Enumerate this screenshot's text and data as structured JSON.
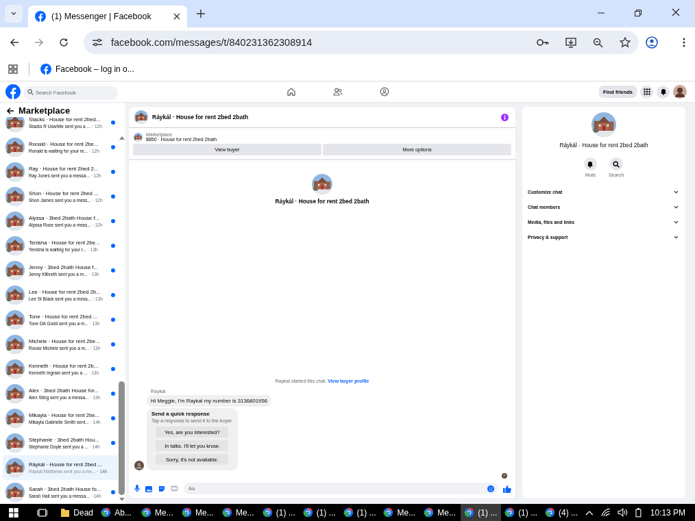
{
  "browser": {
    "tab_title": "(1) Messenger | Facebook",
    "url": "facebook.com/messages/t/840231362308914",
    "bookmark": "Facebook – log in o..."
  },
  "topbar": {
    "search_placeholder": "Search Facebook",
    "find_friends": "Find friends"
  },
  "sidebar": {
    "title": "Marketplace",
    "conversations": [
      {
        "name": "Stacks · House for rent 2bed...",
        "preview": "Stacks R Uswhite sent you a ...",
        "time": "· 12h",
        "unread": true,
        "selected": false
      },
      {
        "name": "Ronald · House for rent 2be...",
        "preview": "Ronald is waiting for your re...",
        "time": "· 12h",
        "unread": true,
        "selected": false
      },
      {
        "name": "Ray · House for rent 2bed 2...",
        "preview": "Ray Jones sent you a messa...",
        "time": "· 12h",
        "unread": true,
        "selected": false
      },
      {
        "name": "Shon · House for rent 2bed ...",
        "preview": "Shon James sent you a mess...",
        "time": "· 12h",
        "unread": true,
        "selected": false
      },
      {
        "name": "Alyssa · 3bed 2bath House f...",
        "preview": "Alyssa Rose sent you a mess...",
        "time": "· 12h",
        "unread": true,
        "selected": false
      },
      {
        "name": "Tenisha · House for rent 2be...",
        "preview": "Tenisha is waiting for your r...",
        "time": "· 13h",
        "unread": true,
        "selected": false
      },
      {
        "name": "Jenny · 3bed 2bath House f...",
        "preview": "Jenny Kilbreth sent you a m...",
        "time": "· 13h",
        "unread": true,
        "selected": false
      },
      {
        "name": "Lee · House for rent 2bed 2b...",
        "preview": "Lee St Black sent you a mess...",
        "time": "· 13h",
        "unread": true,
        "selected": false
      },
      {
        "name": "Tone · House for rent 2bed ...",
        "preview": "Tone DA Godd sent you a m...",
        "time": "· 13h",
        "unread": true,
        "selected": false
      },
      {
        "name": "Michele · House for rent 2be...",
        "preview": "Rouse Michele sent you a m...",
        "time": "· 13h",
        "unread": true,
        "selected": false
      },
      {
        "name": "Kenneth · House for rent 2b...",
        "preview": "Kenneth Ingram sent you a ...",
        "time": "· 13h",
        "unread": true,
        "selected": false
      },
      {
        "name": "Alex · 3bed 2bath House for...",
        "preview": "Alex Sting sent you a messa...",
        "time": "· 13h",
        "unread": true,
        "selected": false
      },
      {
        "name": "Mikayla · House for rent 2be...",
        "preview": "Mikayla Gabrielle Smith sent...",
        "time": "· 14h",
        "unread": true,
        "selected": false
      },
      {
        "name": "Stephanie · 3bed 2bath Hou...",
        "preview": "Stephanie Doyle sent you a ...",
        "time": "· 14h",
        "unread": true,
        "selected": false
      },
      {
        "name": "Ráykál · House for rent 2bed ...",
        "preview": "Ráykál Mátthews sent you a me...",
        "time": "· 14h",
        "unread": false,
        "selected": true
      },
      {
        "name": "Sarah · 3bed 2bath House fo...",
        "preview": "Sarah Hall sent you a messa...",
        "time": "· 14h",
        "unread": true,
        "selected": false
      }
    ]
  },
  "chat": {
    "title": "Ráykál · House for rent 2bed 2bath",
    "listing": {
      "category": "Marketplace",
      "summary": "$850 · House for rent 2bed 2bath"
    },
    "buttons": [
      "View buyer",
      "More options"
    ],
    "intro_title": "Ráykál · House for rent 2bed 2bath",
    "started_text": "Raykal started this chat.",
    "started_link": "View buyer profile",
    "sender": "Raykal",
    "message": "Hi Meggie, I'm Raykal my number is 3136801956",
    "quick": {
      "title": "Send a quick response",
      "subtitle": "Tap a response to send it to the buyer.",
      "responses": [
        "Yes, are you interested?",
        "In talks. I'll let you know.",
        "Sorry, it's not available."
      ]
    },
    "composer_placeholder": "Aa"
  },
  "details": {
    "title": "Ráykál · House for rent 2bed 2bath",
    "actions": [
      {
        "label": "Mute",
        "kind": "bell"
      },
      {
        "label": "Search",
        "kind": "search"
      }
    ],
    "sections": [
      "Customize chat",
      "Chat members",
      "Media, files and links",
      "Privacy & support"
    ]
  },
  "taskbar": {
    "items": [
      {
        "label": "Dead",
        "kind": "folder",
        "selected": false
      },
      {
        "label": "Ab...",
        "kind": "browser",
        "selected": false
      },
      {
        "label": "Me...",
        "kind": "browser",
        "selected": false
      },
      {
        "label": "Me...",
        "kind": "browser",
        "selected": false
      },
      {
        "label": "Me...",
        "kind": "browser",
        "selected": false
      },
      {
        "label": "(1) ...",
        "kind": "browser",
        "selected": false
      },
      {
        "label": "(1) ...",
        "kind": "browser",
        "selected": false
      },
      {
        "label": "(1) ...",
        "kind": "browser",
        "selected": false
      },
      {
        "label": "Me...",
        "kind": "browser",
        "selected": false
      },
      {
        "label": "Me...",
        "kind": "browser",
        "selected": false
      },
      {
        "label": "(1) ...",
        "kind": "browser",
        "selected": true
      },
      {
        "label": "(1) ...",
        "kind": "browser",
        "selected": false
      },
      {
        "label": "(4) ...",
        "kind": "browser",
        "selected": false
      }
    ],
    "clock": "10:13 PM"
  }
}
